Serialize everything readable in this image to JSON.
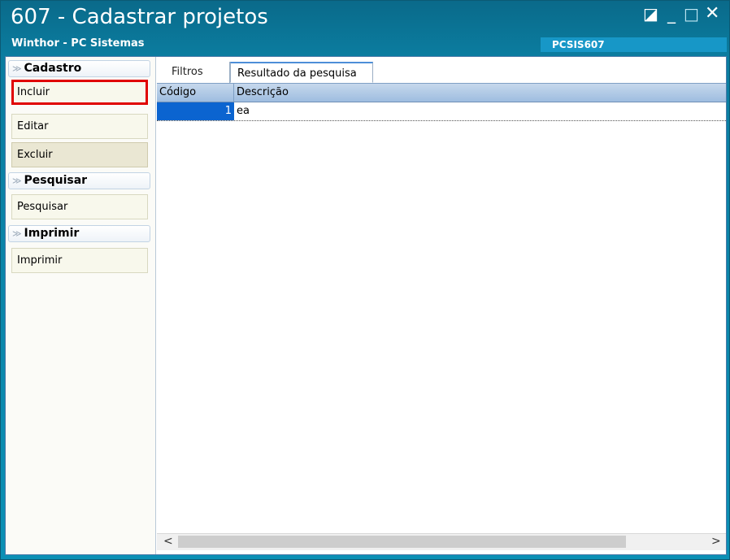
{
  "window": {
    "title": "607 - Cadastrar projetos",
    "subtitle": "Winthor - PC Sistemas",
    "routine_code": "PCSIS607",
    "controls": {
      "restore": "◪",
      "minimize": "_",
      "maximize": "□",
      "close": "✕"
    }
  },
  "sidebar": {
    "groups": [
      {
        "label": "Cadastro",
        "items": [
          "Incluir",
          "Editar",
          "Excluir"
        ]
      },
      {
        "label": "Pesquisar",
        "items": [
          "Pesquisar"
        ]
      },
      {
        "label": "Imprimir",
        "items": [
          "Imprimir"
        ]
      }
    ],
    "chevron": "≫"
  },
  "tabs": [
    {
      "label": "Filtros",
      "active": false
    },
    {
      "label": "Resultado da pesquisa",
      "active": true
    }
  ],
  "grid": {
    "columns": [
      "Código",
      "Descrição"
    ],
    "rows": [
      {
        "codigo": "1",
        "descricao": "ea"
      }
    ]
  },
  "scrollbar": {
    "left": "<",
    "right": ">"
  },
  "colors": {
    "accent": "#0b90b5",
    "selection": "#0b64d0",
    "highlight_border": "#e00000"
  }
}
